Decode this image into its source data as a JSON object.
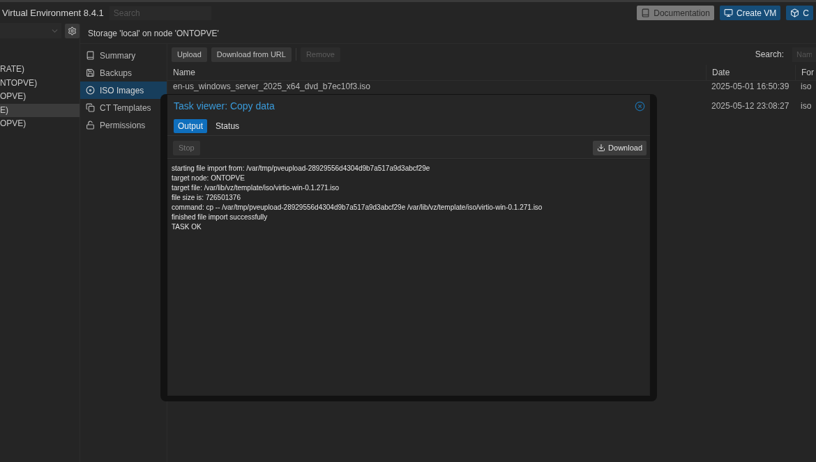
{
  "header": {
    "title": "Virtual Environment 8.4.1",
    "search": {
      "placeholder": "Search"
    },
    "buttons": [
      {
        "label": "Documentation",
        "kind": "plain"
      },
      {
        "label": "Create VM",
        "kind": "primary"
      },
      {
        "label": "C",
        "kind": "primary"
      }
    ]
  },
  "tree": {
    "items": [
      {
        "label": "RATE)",
        "selected": false
      },
      {
        "label": "NTOPVE)",
        "selected": false
      },
      {
        "label": "OPVE)",
        "selected": false
      },
      {
        "label": "E)",
        "selected": true
      },
      {
        "label": "OPVE)",
        "selected": false
      }
    ]
  },
  "content": {
    "title": "Storage 'local' on node 'ONTOPVE'",
    "nav": [
      {
        "label": "Summary",
        "selected": false
      },
      {
        "label": "Backups",
        "selected": false
      },
      {
        "label": "ISO Images",
        "selected": true
      },
      {
        "label": "CT Templates",
        "selected": false
      },
      {
        "label": "Permissions",
        "selected": false
      }
    ],
    "toolbar": {
      "buttons": [
        {
          "label": "Upload",
          "disabled": false
        },
        {
          "label": "Download from URL",
          "disabled": false
        },
        {
          "label": "Remove",
          "disabled": true
        }
      ],
      "search_label": "Search:",
      "search_placeholder": "Nam"
    },
    "table": {
      "columns": [
        "Name",
        "Date",
        "For"
      ],
      "rows": [
        {
          "name": "en-us_windows_server_2025_x64_dvd_b7ec10f3.iso",
          "date": "2025-05-01 16:50:39",
          "format": "iso"
        },
        {
          "date": "2025-05-12 23:08:27",
          "format": "iso"
        }
      ]
    }
  },
  "dialog": {
    "title": "Task viewer: Copy data",
    "tabs": [
      {
        "label": "Output",
        "selected": true
      },
      {
        "label": "Status",
        "selected": false
      }
    ],
    "stop": {
      "label": "Stop",
      "disabled": true
    },
    "download": {
      "label": "Download"
    },
    "log": [
      "starting file import from: /var/tmp/pveupload-28929556d4304d9b7a517a9d3abcf29e",
      "target node: ONTOPVE",
      "target file: /var/lib/vz/template/iso/virtio-win-0.1.271.iso",
      "file size is: 726501376",
      "command: cp -- /var/tmp/pveupload-28929556d4304d9b7a517a9d3abcf29e /var/lib/vz/template/iso/virtio-win-0.1.271.iso",
      "finished file import successfully",
      "TASK OK"
    ]
  }
}
